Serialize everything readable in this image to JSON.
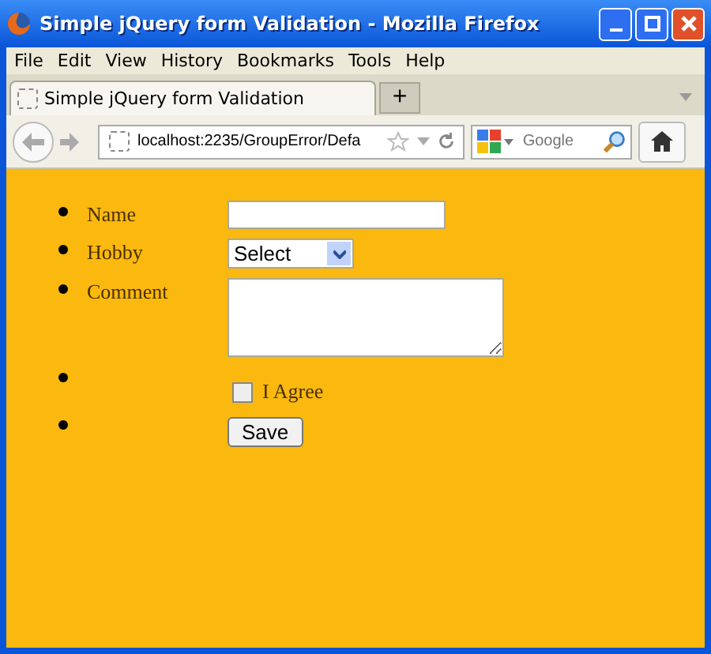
{
  "window": {
    "title": "Simple jQuery form Validation - Mozilla Firefox"
  },
  "menu": [
    "File",
    "Edit",
    "View",
    "History",
    "Bookmarks",
    "Tools",
    "Help"
  ],
  "tabs": [
    {
      "label": "Simple jQuery form Validation",
      "selected": true
    }
  ],
  "new_tab": "+",
  "address": {
    "value": "localhost:2235/GroupError/Defa"
  },
  "search": {
    "placeholder": "Google"
  },
  "form": [
    {
      "kind": "text",
      "label": "Name"
    },
    {
      "kind": "select",
      "label": "Hobby",
      "value": "Select"
    },
    {
      "kind": "textarea",
      "label": "Comment"
    },
    {
      "kind": "checkbox",
      "label": "I Agree",
      "checked": false
    },
    {
      "kind": "button",
      "label": "Save"
    }
  ]
}
